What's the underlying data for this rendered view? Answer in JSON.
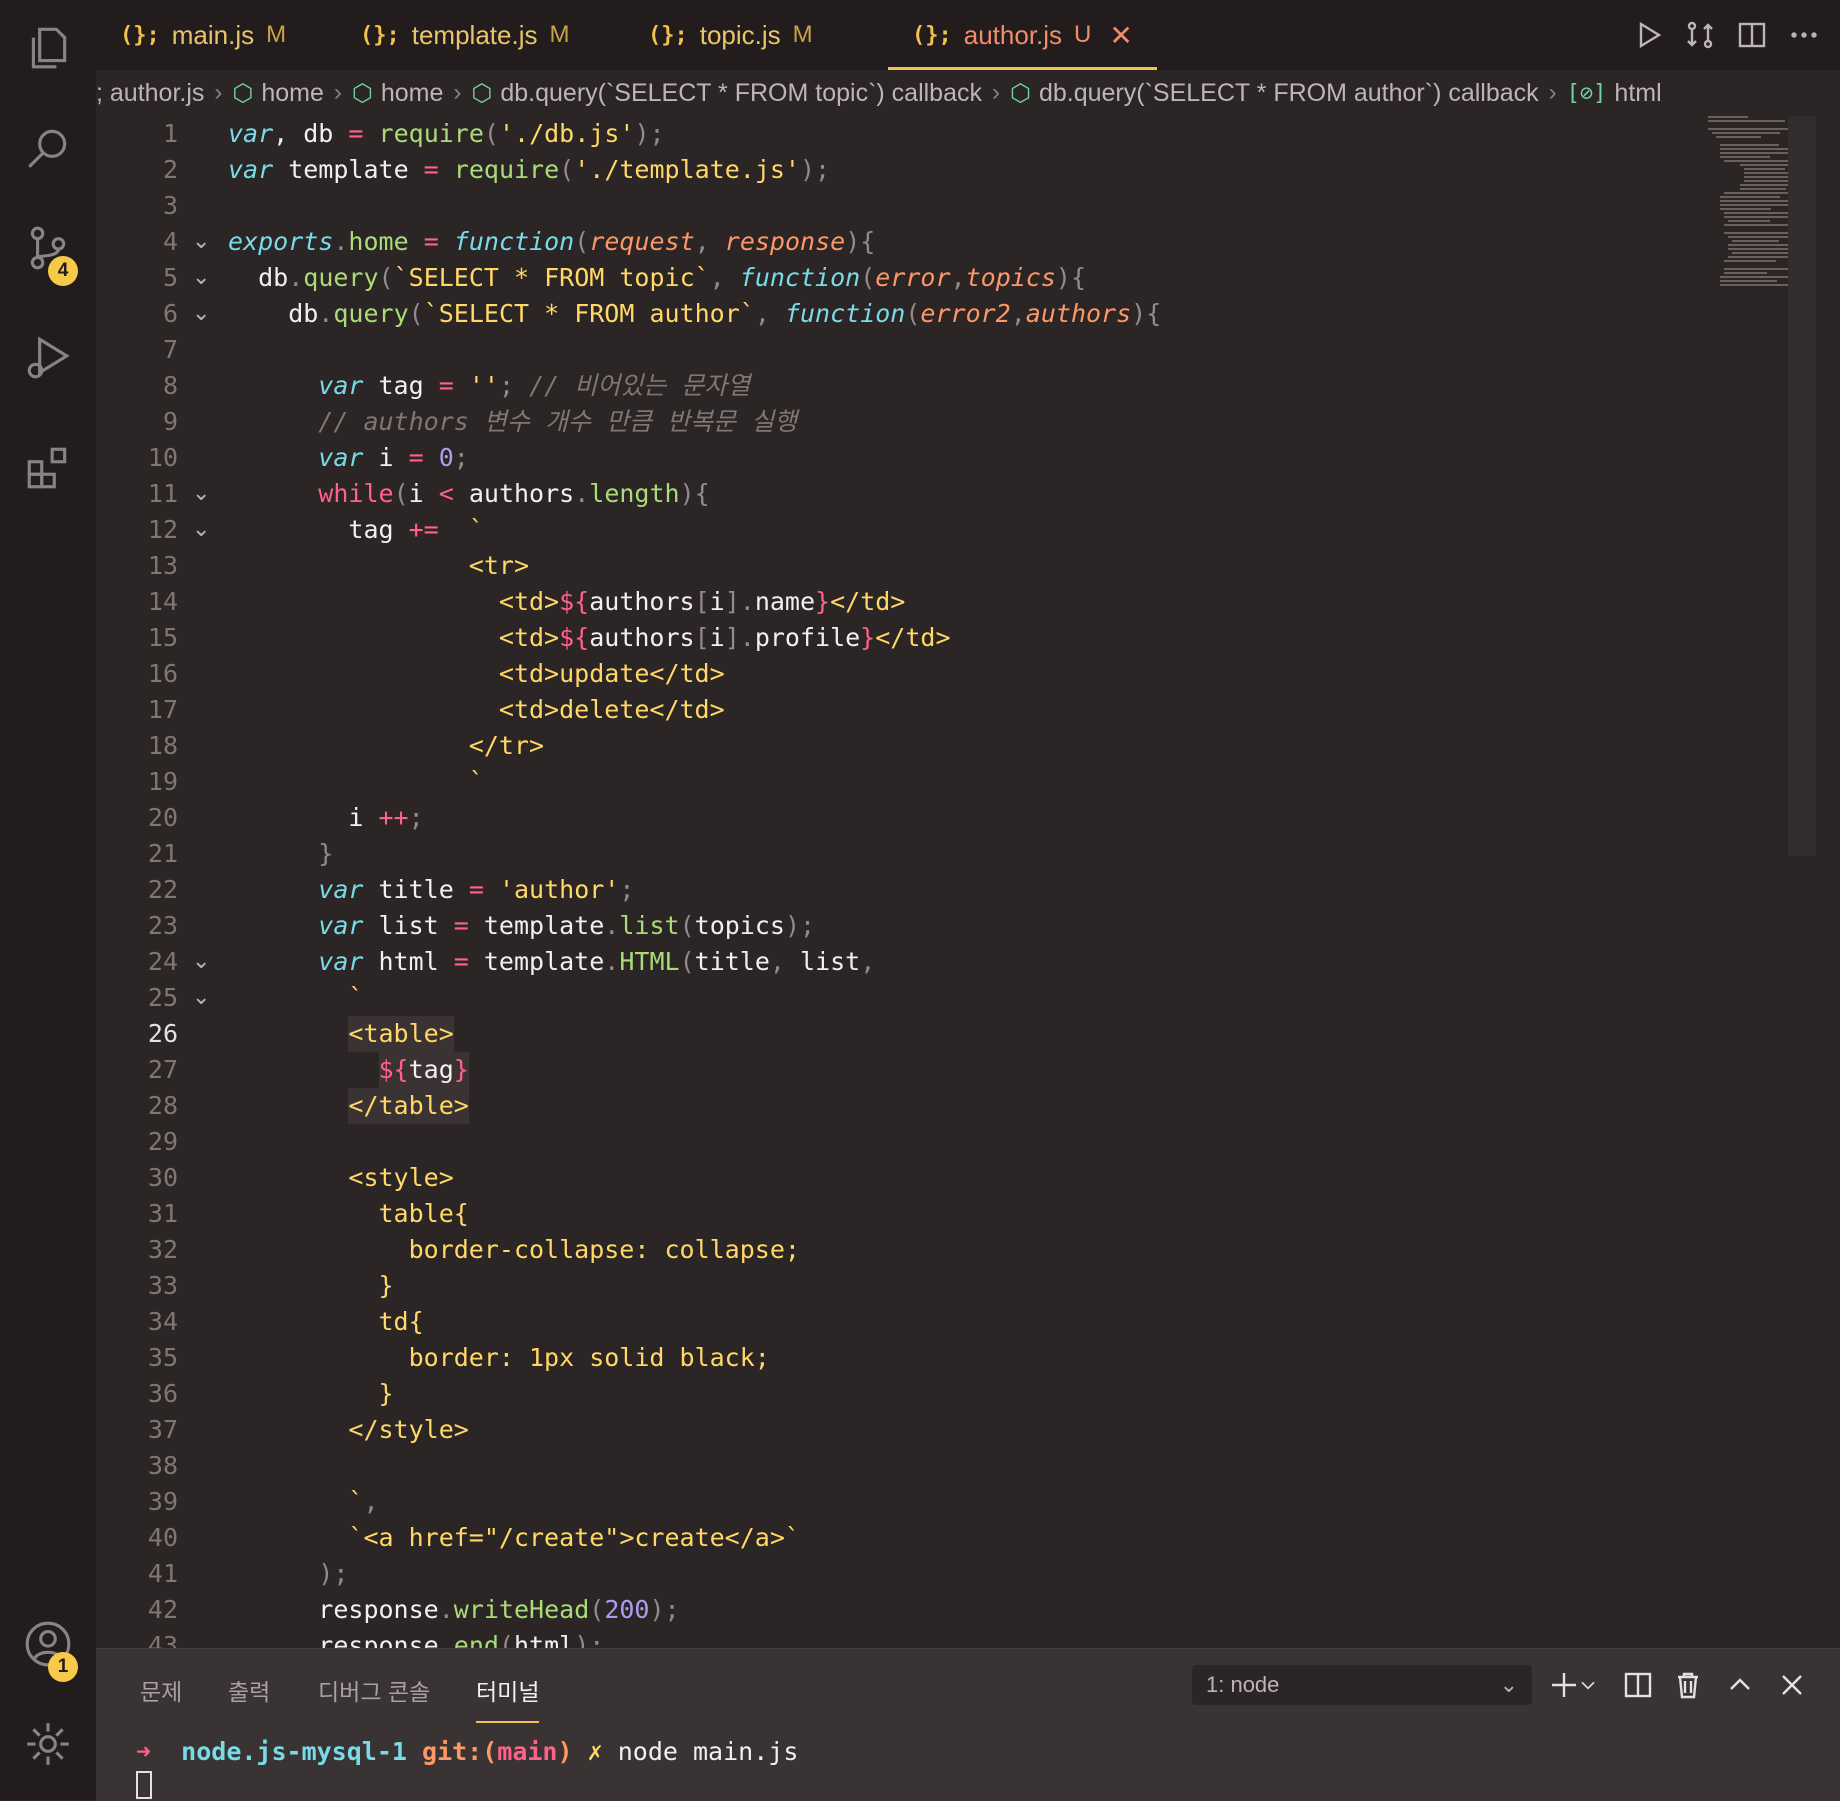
{
  "activity_bar": {
    "source_control_badge": "4",
    "accounts_badge": "1"
  },
  "tabs": [
    {
      "icon": "(){}",
      "label": "main.js",
      "status": "M"
    },
    {
      "icon": "(){}",
      "label": "template.js",
      "status": "M"
    },
    {
      "icon": "(){}",
      "label": "topic.js",
      "status": "M"
    },
    {
      "icon": "(){}",
      "label": "author.js",
      "status": "U"
    }
  ],
  "breadcrumb": [
    "; author.js",
    "home",
    "home",
    "db.query(`SELECT * FROM topic`) callback",
    "db.query(`SELECT * FROM author`) callback",
    "html"
  ],
  "editor": {
    "current_line": 26,
    "lines": [
      {
        "n": "1",
        "fold": false,
        "indent": 0,
        "tokens": [
          [
            "kw",
            "var"
          ],
          [
            "",
            ", db "
          ],
          [
            "op",
            "="
          ],
          [
            "",
            " "
          ],
          [
            "fn",
            "require"
          ],
          [
            "pn",
            "("
          ],
          [
            "str",
            "'./db.js'"
          ],
          [
            "pn",
            ");"
          ]
        ]
      },
      {
        "n": "2",
        "fold": false,
        "indent": 0,
        "tokens": [
          [
            "kw",
            "var"
          ],
          [
            "",
            " template "
          ],
          [
            "op",
            "="
          ],
          [
            "",
            " "
          ],
          [
            "fn",
            "require"
          ],
          [
            "pn",
            "("
          ],
          [
            "str",
            "'./template.js'"
          ],
          [
            "pn",
            ");"
          ]
        ]
      },
      {
        "n": "3",
        "fold": false,
        "indent": 0,
        "tokens": []
      },
      {
        "n": "4",
        "fold": true,
        "indent": 0,
        "tokens": [
          [
            "kw",
            "exports"
          ],
          [
            "pn",
            "."
          ],
          [
            "fn",
            "home"
          ],
          [
            "",
            " "
          ],
          [
            "op",
            "="
          ],
          [
            "",
            " "
          ],
          [
            "kw",
            "function"
          ],
          [
            "pn",
            "("
          ],
          [
            "par",
            "request"
          ],
          [
            "pn",
            ", "
          ],
          [
            "par",
            "response"
          ],
          [
            "pn",
            "){"
          ]
        ]
      },
      {
        "n": "5",
        "fold": true,
        "indent": 1,
        "tokens": [
          [
            "",
            "db"
          ],
          [
            "pn",
            "."
          ],
          [
            "fn",
            "query"
          ],
          [
            "pn",
            "("
          ],
          [
            "str",
            "`SELECT * FROM topic`"
          ],
          [
            "pn",
            ", "
          ],
          [
            "kw",
            "function"
          ],
          [
            "pn",
            "("
          ],
          [
            "par",
            "error"
          ],
          [
            "pn",
            ","
          ],
          [
            "par",
            "topics"
          ],
          [
            "pn",
            "){"
          ]
        ]
      },
      {
        "n": "6",
        "fold": true,
        "indent": 2,
        "tokens": [
          [
            "",
            "db"
          ],
          [
            "pn",
            "."
          ],
          [
            "fn",
            "query"
          ],
          [
            "pn",
            "("
          ],
          [
            "str",
            "`SELECT * FROM author`"
          ],
          [
            "pn",
            ", "
          ],
          [
            "kw",
            "function"
          ],
          [
            "pn",
            "("
          ],
          [
            "par",
            "error2"
          ],
          [
            "pn",
            ","
          ],
          [
            "par",
            "authors"
          ],
          [
            "pn",
            "){"
          ]
        ]
      },
      {
        "n": "7",
        "fold": false,
        "indent": 0,
        "tokens": []
      },
      {
        "n": "8",
        "fold": false,
        "indent": 3,
        "tokens": [
          [
            "kw",
            "var"
          ],
          [
            "",
            " tag "
          ],
          [
            "op",
            "="
          ],
          [
            "",
            " "
          ],
          [
            "str",
            "''"
          ],
          [
            "pn",
            "; "
          ],
          [
            "cm",
            "// 비어있는 문자열"
          ]
        ]
      },
      {
        "n": "9",
        "fold": false,
        "indent": 3,
        "tokens": [
          [
            "cm",
            "// authors 변수 개수 만큼 반복문 실행"
          ]
        ]
      },
      {
        "n": "10",
        "fold": false,
        "indent": 3,
        "tokens": [
          [
            "kw",
            "var"
          ],
          [
            "",
            " i "
          ],
          [
            "op",
            "="
          ],
          [
            "",
            " "
          ],
          [
            "num",
            "0"
          ],
          [
            "pn",
            ";"
          ]
        ]
      },
      {
        "n": "11",
        "fold": true,
        "indent": 3,
        "tokens": [
          [
            "kp",
            "while"
          ],
          [
            "pn",
            "("
          ],
          [
            "",
            "i "
          ],
          [
            "op",
            "<"
          ],
          [
            "",
            " authors"
          ],
          [
            "pn",
            "."
          ],
          [
            "fn",
            "length"
          ],
          [
            "pn",
            "){"
          ]
        ]
      },
      {
        "n": "12",
        "fold": true,
        "indent": 4,
        "tokens": [
          [
            "",
            "tag "
          ],
          [
            "op",
            "+="
          ],
          [
            "",
            "  "
          ],
          [
            "str",
            "`"
          ]
        ]
      },
      {
        "n": "13",
        "fold": false,
        "indent": 8,
        "tokens": [
          [
            "str",
            "<tr>"
          ]
        ]
      },
      {
        "n": "14",
        "fold": false,
        "indent": 9,
        "tokens": [
          [
            "str",
            "<td>"
          ],
          [
            "kp",
            "${"
          ],
          [
            "",
            "authors"
          ],
          [
            "pn",
            "["
          ],
          [
            "",
            "i"
          ],
          [
            "pn",
            "]."
          ],
          [
            "",
            "name"
          ],
          [
            "kp",
            "}"
          ],
          [
            "str",
            "</td>"
          ]
        ]
      },
      {
        "n": "15",
        "fold": false,
        "indent": 9,
        "tokens": [
          [
            "str",
            "<td>"
          ],
          [
            "kp",
            "${"
          ],
          [
            "",
            "authors"
          ],
          [
            "pn",
            "["
          ],
          [
            "",
            "i"
          ],
          [
            "pn",
            "]."
          ],
          [
            "",
            "profile"
          ],
          [
            "kp",
            "}"
          ],
          [
            "str",
            "</td>"
          ]
        ]
      },
      {
        "n": "16",
        "fold": false,
        "indent": 9,
        "tokens": [
          [
            "str",
            "<td>update</td>"
          ]
        ]
      },
      {
        "n": "17",
        "fold": false,
        "indent": 9,
        "tokens": [
          [
            "str",
            "<td>delete</td>"
          ]
        ]
      },
      {
        "n": "18",
        "fold": false,
        "indent": 8,
        "tokens": [
          [
            "str",
            "</tr>"
          ]
        ]
      },
      {
        "n": "19",
        "fold": false,
        "indent": 8,
        "tokens": [
          [
            "str",
            "`"
          ]
        ]
      },
      {
        "n": "20",
        "fold": false,
        "indent": 4,
        "tokens": [
          [
            "",
            "i "
          ],
          [
            "op",
            "++"
          ],
          [
            "pn",
            ";"
          ]
        ]
      },
      {
        "n": "21",
        "fold": false,
        "indent": 3,
        "tokens": [
          [
            "pn",
            "}"
          ]
        ]
      },
      {
        "n": "22",
        "fold": false,
        "indent": 3,
        "tokens": [
          [
            "kw",
            "var"
          ],
          [
            "",
            " title "
          ],
          [
            "op",
            "="
          ],
          [
            "",
            " "
          ],
          [
            "str",
            "'author'"
          ],
          [
            "pn",
            ";"
          ]
        ]
      },
      {
        "n": "23",
        "fold": false,
        "indent": 3,
        "tokens": [
          [
            "kw",
            "var"
          ],
          [
            "",
            " list "
          ],
          [
            "op",
            "="
          ],
          [
            "",
            " template"
          ],
          [
            "pn",
            "."
          ],
          [
            "fn",
            "list"
          ],
          [
            "pn",
            "("
          ],
          [
            "",
            "topics"
          ],
          [
            "pn",
            ");"
          ]
        ]
      },
      {
        "n": "24",
        "fold": true,
        "indent": 3,
        "tokens": [
          [
            "kw",
            "var"
          ],
          [
            "",
            " html "
          ],
          [
            "op",
            "="
          ],
          [
            "",
            " template"
          ],
          [
            "pn",
            "."
          ],
          [
            "fn",
            "HTML"
          ],
          [
            "pn",
            "("
          ],
          [
            "",
            "title"
          ],
          [
            "pn",
            ", "
          ],
          [
            "",
            "list"
          ],
          [
            "pn",
            ","
          ]
        ]
      },
      {
        "n": "25",
        "fold": true,
        "indent": 4,
        "tokens": [
          [
            "str",
            "`"
          ]
        ]
      },
      {
        "n": "26",
        "fold": false,
        "indent": 4,
        "hl": true,
        "tokens": [
          [
            "str",
            "<table>"
          ]
        ]
      },
      {
        "n": "27",
        "fold": false,
        "indent": 5,
        "hl": true,
        "tokens": [
          [
            "kp",
            "${"
          ],
          [
            "",
            "tag"
          ],
          [
            "kp",
            "}"
          ]
        ]
      },
      {
        "n": "28",
        "fold": false,
        "indent": 4,
        "hl": true,
        "tokens": [
          [
            "str",
            "</table>"
          ]
        ]
      },
      {
        "n": "29",
        "fold": false,
        "indent": 0,
        "tokens": []
      },
      {
        "n": "30",
        "fold": false,
        "indent": 4,
        "tokens": [
          [
            "str",
            "<style>"
          ]
        ]
      },
      {
        "n": "31",
        "fold": false,
        "indent": 5,
        "tokens": [
          [
            "str",
            "table{"
          ]
        ]
      },
      {
        "n": "32",
        "fold": false,
        "indent": 6,
        "tokens": [
          [
            "str",
            "border-collapse: collapse;"
          ]
        ]
      },
      {
        "n": "33",
        "fold": false,
        "indent": 5,
        "tokens": [
          [
            "str",
            "}"
          ]
        ]
      },
      {
        "n": "34",
        "fold": false,
        "indent": 5,
        "tokens": [
          [
            "str",
            "td{"
          ]
        ]
      },
      {
        "n": "35",
        "fold": false,
        "indent": 6,
        "tokens": [
          [
            "str",
            "border: 1px solid black;"
          ]
        ]
      },
      {
        "n": "36",
        "fold": false,
        "indent": 5,
        "tokens": [
          [
            "str",
            "}"
          ]
        ]
      },
      {
        "n": "37",
        "fold": false,
        "indent": 4,
        "tokens": [
          [
            "str",
            "</style>"
          ]
        ]
      },
      {
        "n": "38",
        "fold": false,
        "indent": 0,
        "tokens": []
      },
      {
        "n": "39",
        "fold": false,
        "indent": 4,
        "tokens": [
          [
            "str",
            "`"
          ],
          [
            "pn",
            ","
          ]
        ]
      },
      {
        "n": "40",
        "fold": false,
        "indent": 4,
        "tokens": [
          [
            "str",
            "`<a href=\"/create\">create</a>`"
          ]
        ]
      },
      {
        "n": "41",
        "fold": false,
        "indent": 3,
        "tokens": [
          [
            "pn",
            ");"
          ]
        ]
      },
      {
        "n": "42",
        "fold": false,
        "indent": 3,
        "tokens": [
          [
            "",
            "response"
          ],
          [
            "pn",
            "."
          ],
          [
            "fn",
            "writeHead"
          ],
          [
            "pn",
            "("
          ],
          [
            "num",
            "200"
          ],
          [
            "pn",
            ");"
          ]
        ]
      },
      {
        "n": "43",
        "fold": false,
        "indent": 3,
        "tokens": [
          [
            "",
            "response"
          ],
          [
            "pn",
            "."
          ],
          [
            "fn",
            "end"
          ],
          [
            "pn",
            "("
          ],
          [
            "",
            "html"
          ],
          [
            "pn",
            ");"
          ]
        ]
      }
    ]
  },
  "panel": {
    "tabs": [
      "문제",
      "출력",
      "디버그 콘솔",
      "터미널"
    ],
    "active_tab": "터미널",
    "terminal_select": "1: node",
    "prompt": {
      "arrow": "➜",
      "dir": "node.js-mysql-1",
      "git_label": "git:(",
      "branch": "main",
      "git_close": ")",
      "dirty": "✗",
      "command": "node main.js"
    }
  },
  "colors": {
    "accent": "#f2c14e",
    "background": "#2c2525",
    "string": "#ffd866",
    "keyword": "#78dce8",
    "function": "#a9dc76"
  }
}
